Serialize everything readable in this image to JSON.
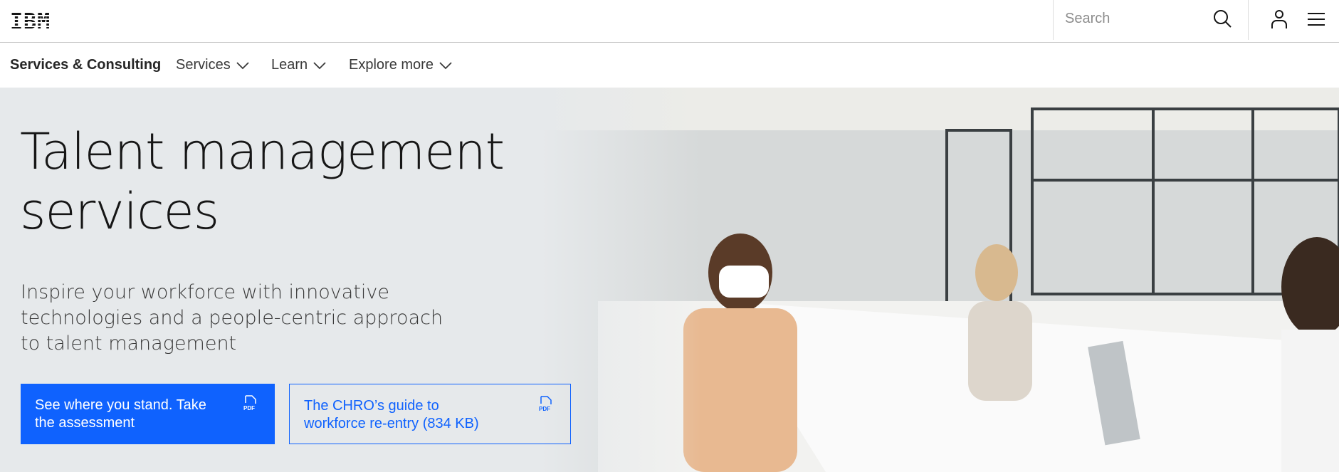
{
  "header": {
    "logo": "IBM",
    "search_placeholder": "Search"
  },
  "nav": {
    "brand": "Services & Consulting",
    "items": [
      {
        "label": "Services"
      },
      {
        "label": "Learn"
      },
      {
        "label": "Explore more"
      }
    ]
  },
  "hero": {
    "title_line1": "Talent management",
    "title_line2": "services",
    "subtitle": "Inspire your workforce with innovative technologies and a people-centric approach to talent management",
    "primary_button": "See where you stand. Take the assessment",
    "secondary_button": "The CHRO’s guide to workforce re-entry (834 KB)",
    "pdf_icon_text": "PDF"
  },
  "colors": {
    "accent": "#0f62fe",
    "hero_bg": "#e6e9eb"
  }
}
